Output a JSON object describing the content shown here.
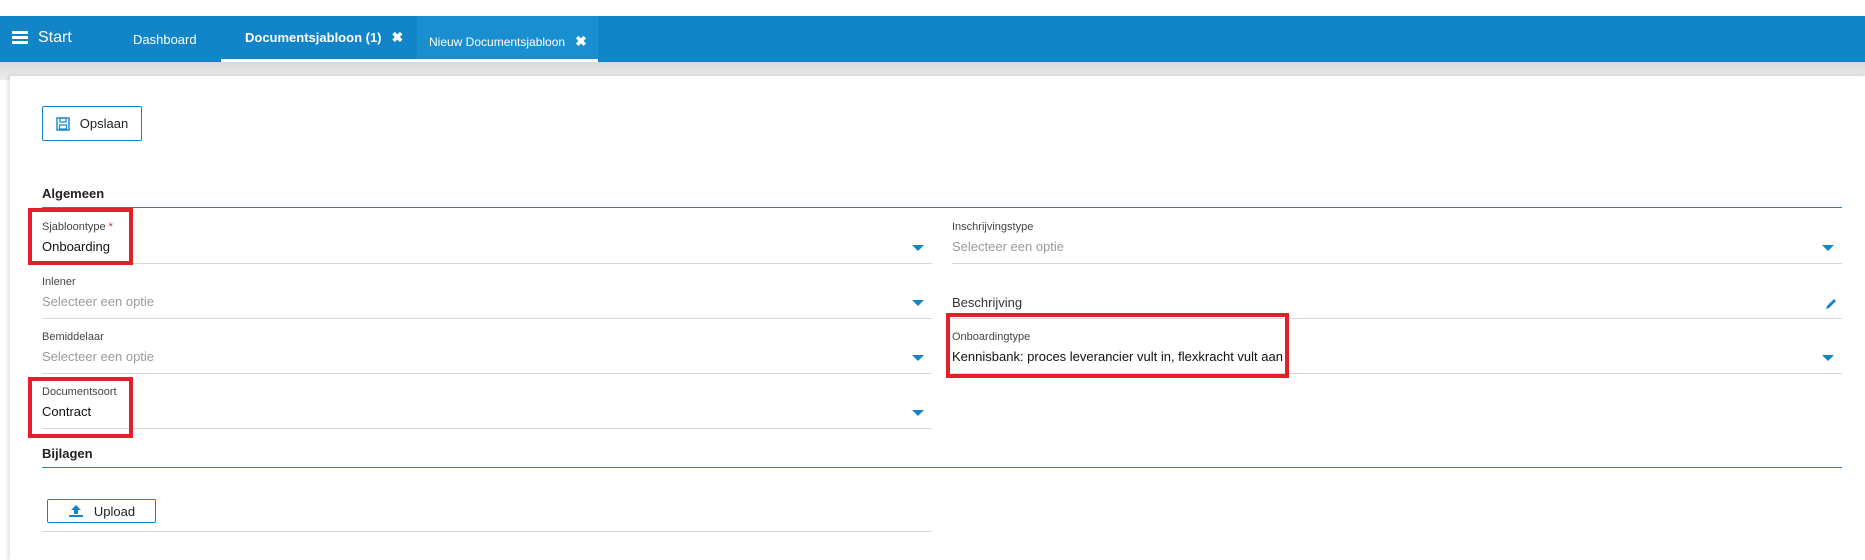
{
  "topbar": {
    "start_label": "Start",
    "tabs": [
      {
        "label": "Dashboard"
      },
      {
        "label": "Documentsjabloon (1)",
        "close": "✖"
      },
      {
        "label": "Nieuw Documentsjabloon",
        "close": "✖"
      }
    ]
  },
  "toolbar": {
    "save_label": "Opslaan"
  },
  "sections": {
    "general": "Algemeen",
    "attachments": "Bijlagen"
  },
  "fields": {
    "sjabloontype": {
      "label": "Sjabloontype",
      "required_mark": "*",
      "value": "Onboarding"
    },
    "inschrijvingstype": {
      "label": "Inschrijvingstype",
      "placeholder": "Selecteer een optie"
    },
    "inlener": {
      "label": "Inlener",
      "placeholder": "Selecteer een optie"
    },
    "beschrijving": {
      "label": "Beschrijving"
    },
    "bemiddelaar": {
      "label": "Bemiddelaar",
      "placeholder": "Selecteer een optie"
    },
    "onboardingtype": {
      "label": "Onboardingtype",
      "value": "Kennisbank: proces leverancier vult in, flexkracht vult aan"
    },
    "documentsoort": {
      "label": "Documentsoort",
      "value": "Contract"
    }
  },
  "upload": {
    "label": "Upload"
  },
  "colors": {
    "accent": "#1185c7",
    "highlight": "#e3202a"
  }
}
